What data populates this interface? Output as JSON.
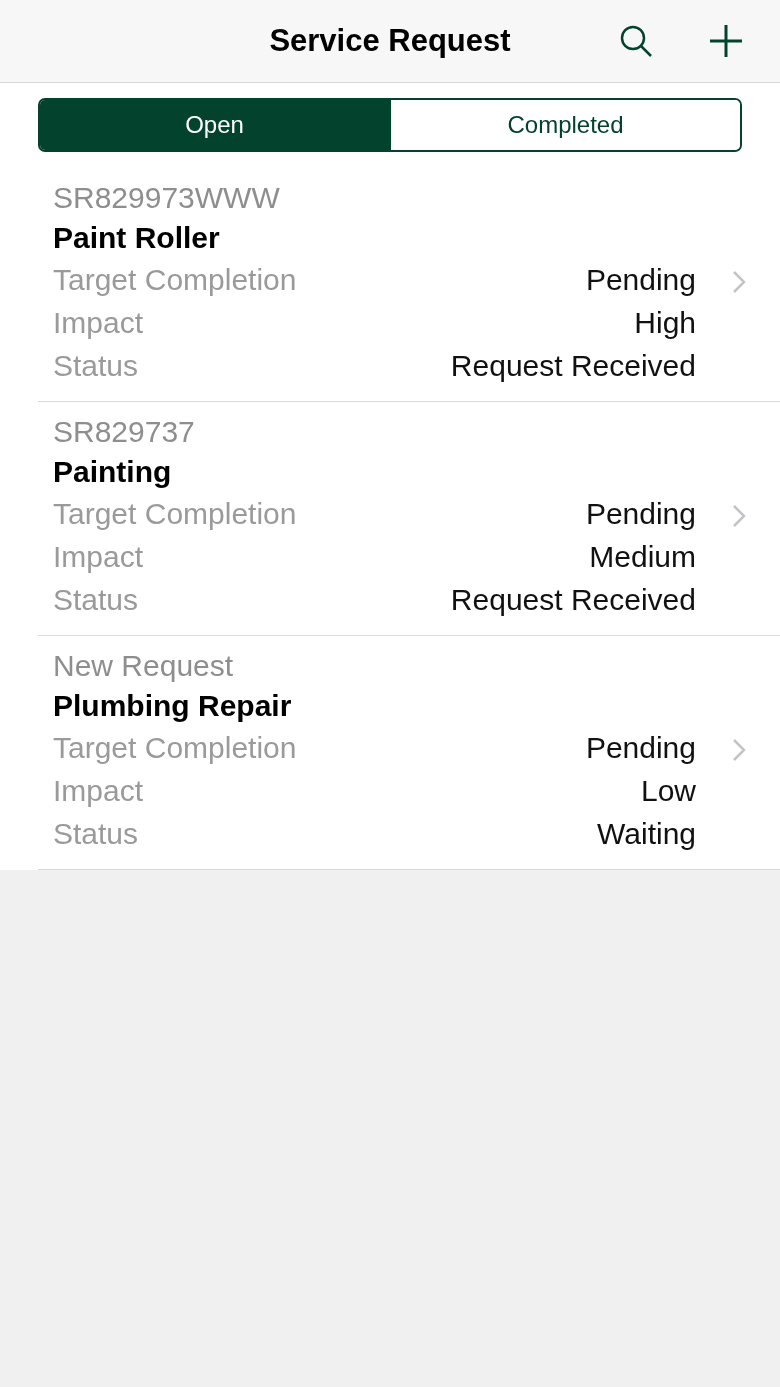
{
  "header": {
    "title": "Service Request"
  },
  "tabs": [
    {
      "label": "Open",
      "selected": true
    },
    {
      "label": "Completed",
      "selected": false
    }
  ],
  "requests": [
    {
      "id": "SR829973WWW",
      "title": "Paint Roller",
      "fields": [
        {
          "label": "Target Completion",
          "value": "Pending"
        },
        {
          "label": "Impact",
          "value": "High"
        },
        {
          "label": "Status",
          "value": "Request Received"
        }
      ]
    },
    {
      "id": "SR829737",
      "title": "Painting",
      "fields": [
        {
          "label": "Target Completion",
          "value": "Pending"
        },
        {
          "label": "Impact",
          "value": "Medium"
        },
        {
          "label": "Status",
          "value": "Request Received"
        }
      ]
    },
    {
      "id": "New Request",
      "title": "Plumbing Repair",
      "fields": [
        {
          "label": "Target Completion",
          "value": "Pending"
        },
        {
          "label": "Impact",
          "value": "Low"
        },
        {
          "label": "Status",
          "value": "Waiting"
        }
      ]
    }
  ]
}
